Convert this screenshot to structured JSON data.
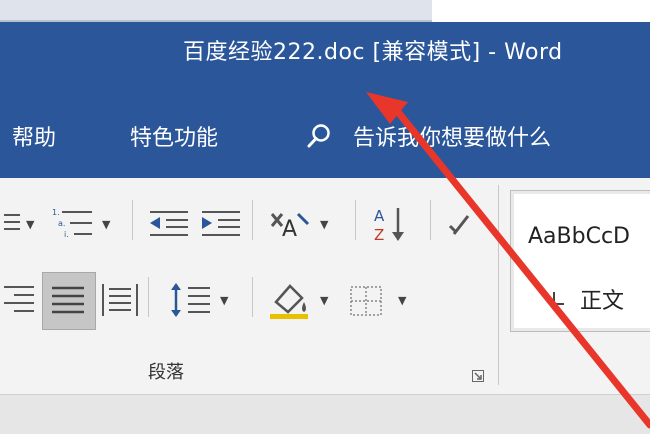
{
  "window": {
    "title": "百度经验222.doc [兼容模式]  -  Word",
    "accent": "#2b579a"
  },
  "menu": {
    "help": "帮助",
    "special_features": "特色功能",
    "tell_me": "告诉我你想要做什么"
  },
  "ribbon": {
    "group_label": "段落",
    "style_preview": "AaBbCcD",
    "style_name": "正文",
    "icons": [
      "numbering-icon",
      "multilevel-list-icon",
      "decrease-indent-icon",
      "increase-indent-icon",
      "chinese-layout-icon",
      "sort-icon",
      "show-marks-icon",
      "align-right-icon",
      "justify-icon",
      "distributed-icon",
      "line-spacing-icon",
      "shading-icon",
      "borders-icon",
      "dialog-launcher-icon"
    ]
  },
  "annotation": {
    "arrow_color": "#e8362b"
  }
}
